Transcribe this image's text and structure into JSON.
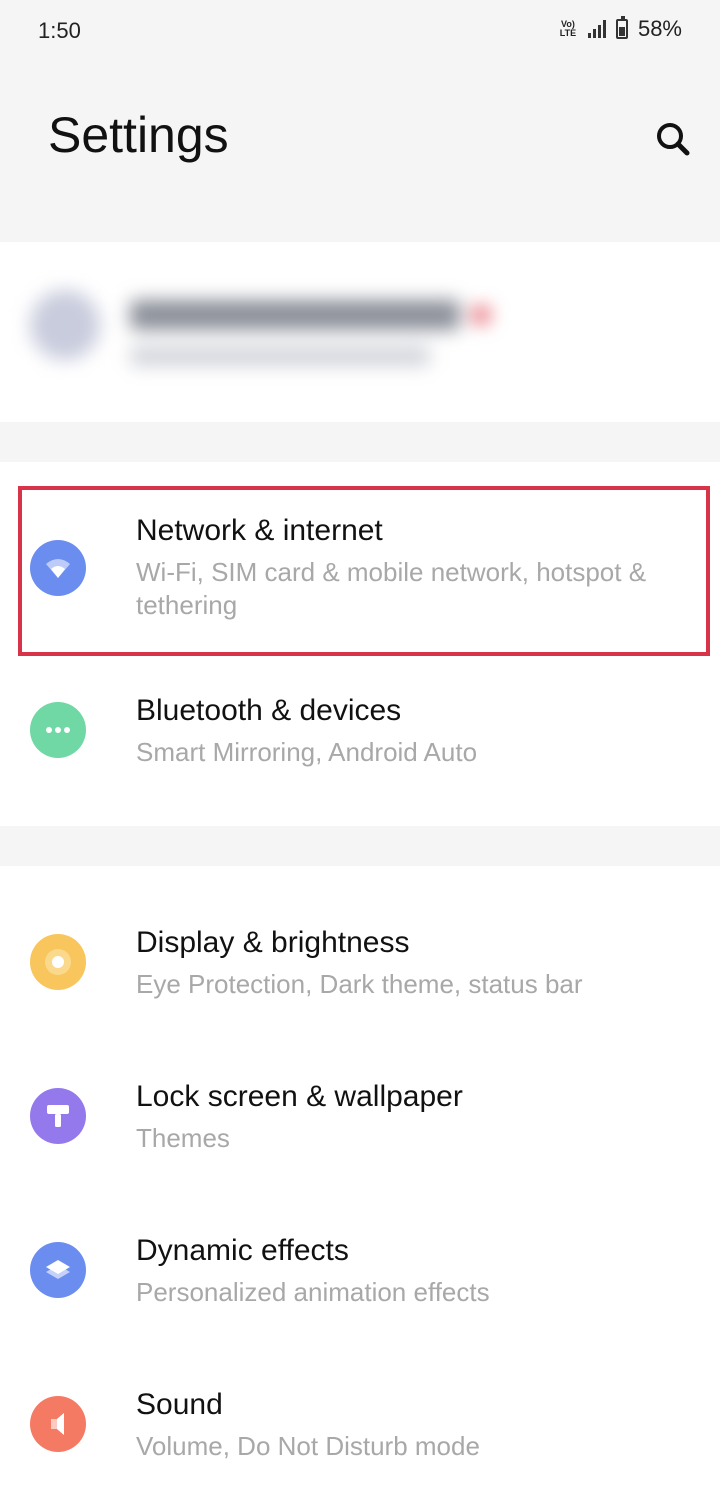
{
  "status_bar": {
    "time": "1:50",
    "volte_top": "Vo)",
    "volte_bottom": "LTE",
    "battery": "58%"
  },
  "header": {
    "title": "Settings"
  },
  "items": [
    {
      "title": "Network & internet",
      "subtitle": "Wi-Fi, SIM card & mobile network, hotspot & tethering",
      "icon": "wifi-icon",
      "color": "#6b8df0"
    },
    {
      "title": "Bluetooth & devices",
      "subtitle": "Smart Mirroring, Android Auto",
      "icon": "more-dots-icon",
      "color": "#6fd8a4"
    },
    {
      "title": "Display & brightness",
      "subtitle": "Eye Protection, Dark theme, status bar",
      "icon": "brightness-icon",
      "color": "#f8c65c"
    },
    {
      "title": "Lock screen & wallpaper",
      "subtitle": "Themes",
      "icon": "paint-roller-icon",
      "color": "#9479ec"
    },
    {
      "title": "Dynamic effects",
      "subtitle": "Personalized animation effects",
      "icon": "layers-icon",
      "color": "#6b8df0"
    },
    {
      "title": "Sound",
      "subtitle": "Volume, Do Not Disturb mode",
      "icon": "speaker-icon",
      "color": "#f57a64"
    }
  ],
  "highlight_color": "#d7344a"
}
